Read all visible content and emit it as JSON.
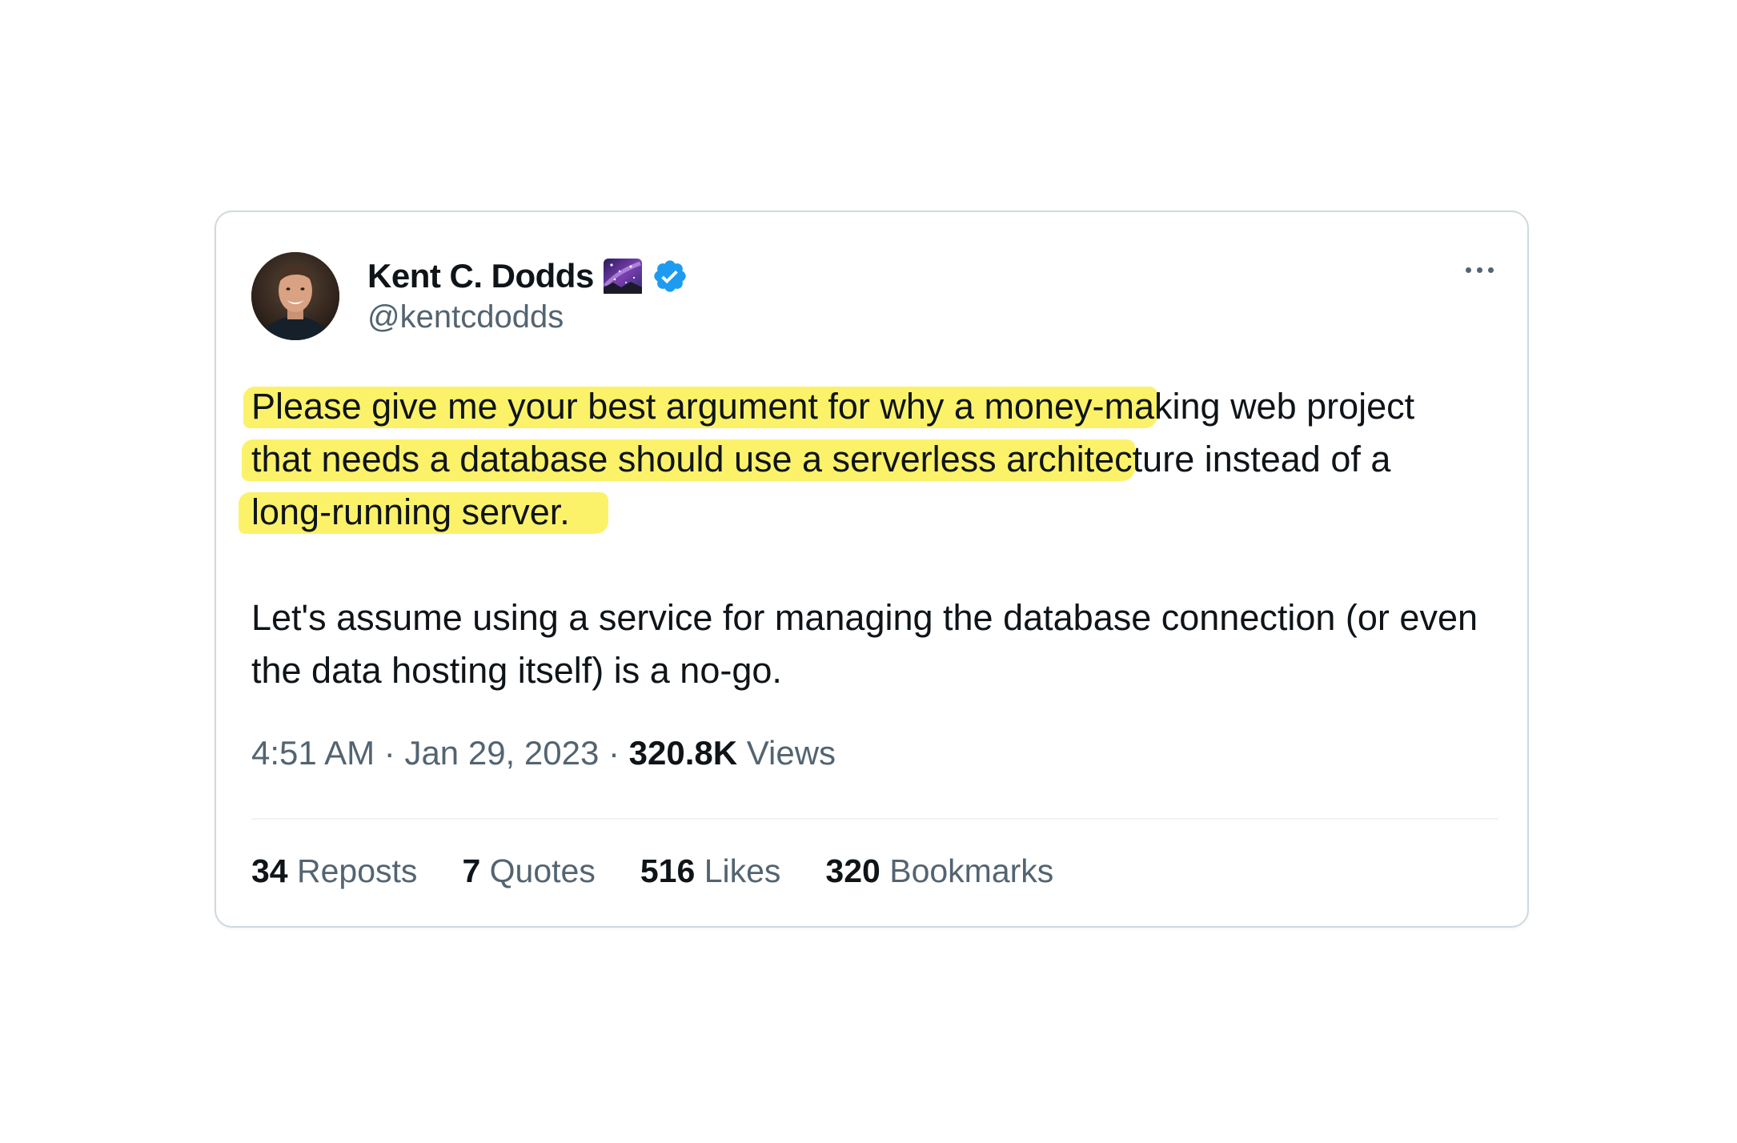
{
  "tweet": {
    "author": {
      "name": "Kent C. Dodds",
      "handle": "@kentcdodds",
      "emoji_icon": "milky-way-emoji",
      "verified_icon": "verified-badge",
      "verified_color": "#1d9bf0"
    },
    "more_icon": "more-options-icon",
    "highlight_color": "#fbf26a",
    "highlighted_lines": [
      "Please give me your best argument for why a money-making web project",
      "that needs a database should use a serverless architecture instead of a",
      "long-running server."
    ],
    "second_paragraph": "Let's assume using a service for managing the database connection (or even the data hosting itself) is a no-go.",
    "meta": {
      "time": "4:51 AM",
      "separator": "·",
      "date": "Jan 29, 2023",
      "views_count": "320.8K",
      "views_label": "Views"
    },
    "stats": [
      {
        "count": "34",
        "label": "Reposts"
      },
      {
        "count": "7",
        "label": "Quotes"
      },
      {
        "count": "516",
        "label": "Likes"
      },
      {
        "count": "320",
        "label": "Bookmarks"
      }
    ]
  }
}
